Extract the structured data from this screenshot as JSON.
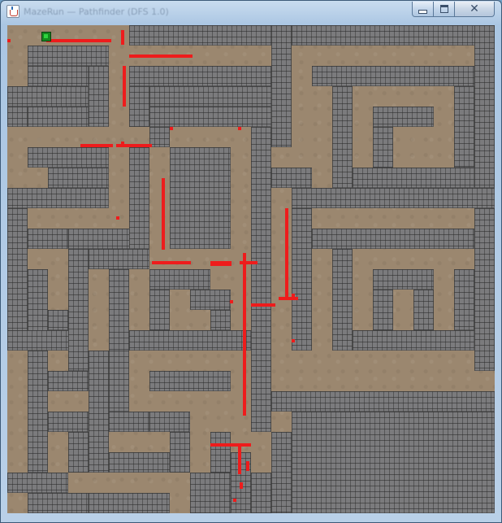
{
  "window": {
    "title": "MazeRun — Pathfinder (DFS 1.0)",
    "controls": {
      "minimize": "minimize",
      "maximize": "maximize",
      "close": "close"
    }
  },
  "game": {
    "grid_cells": 24,
    "board_size": 600,
    "colors": {
      "floor": "#9b876f",
      "wall": "#7b7b7d",
      "path_marker": "#ee1c1c",
      "player": "#148a1e"
    },
    "player": {
      "col": 2,
      "row": 0,
      "label": "player"
    },
    "icons": [
      "java-app-icon",
      "minimize-icon",
      "maximize-icon",
      "close-icon"
    ]
  }
}
